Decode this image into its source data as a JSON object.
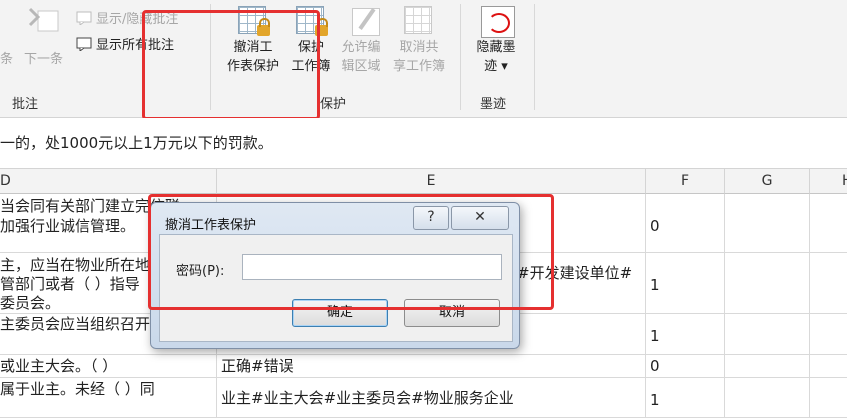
{
  "ribbon": {
    "comments_group": {
      "label": "批注",
      "prev_label": "条",
      "next_label": "下一条",
      "show_hide_label": "显示/隐藏批注",
      "show_all_label": "显示所有批注"
    },
    "protect_group": {
      "label": "保护",
      "unprotect_sheet_l1": "撤消工",
      "unprotect_sheet_l2": "作表保护",
      "protect_wb_l1": "保护",
      "protect_wb_l2": "工作簿",
      "allow_edit_l1": "允许编",
      "allow_edit_l2": "辑区域",
      "unshare_l1": "取消共",
      "unshare_l2": "享工作簿"
    },
    "ink_group": {
      "label": "墨迹",
      "hide_ink_l1": "隐藏墨",
      "hide_ink_l2": "迹 ▾"
    }
  },
  "formula_bar": {
    "text": "一的，处1000元以上1万元以下的罚款。"
  },
  "grid": {
    "columns": [
      "D",
      "E",
      "F",
      "G",
      "H"
    ],
    "rows": [
      {
        "d1": "当会同有关部门建立完信联",
        "d2": "  加强行业诚信管理。",
        "e": "",
        "f": "0"
      },
      {
        "d1": "主，应当在物业所在地",
        "d2": "管部门或者（  ）指导",
        "d3": "委员会。",
        "e": "#开发建设单位#",
        "f": "1"
      },
      {
        "d1": "主委员会应当组织召开",
        "e": "",
        "f": "1"
      },
      {
        "d1": "或业主大会。（    ）",
        "e": "正确#错误",
        "f": "0"
      },
      {
        "d1": "属于业主。未经（    ）同",
        "e": "业主#业主大会#业主委员会#物业服务企业",
        "f": "1"
      }
    ]
  },
  "dialog": {
    "title": "撤消工作表保护",
    "help_label": "?",
    "close_label": "✕",
    "password_label": "密码(P):",
    "password_value": "",
    "ok_label": "确定",
    "cancel_label": "取消"
  },
  "colors": {
    "highlight": "#e53030",
    "ribbon_bg": "#f3f3f3",
    "dialog_bg": "#d5e1ef"
  }
}
